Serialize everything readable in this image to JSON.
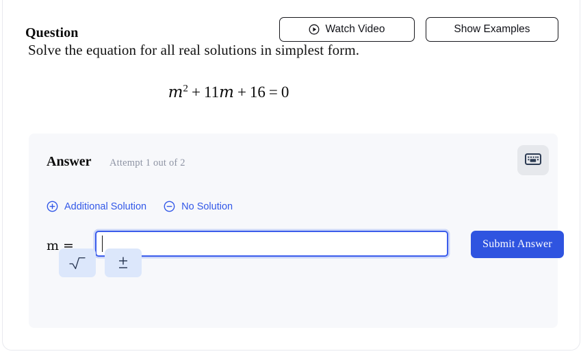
{
  "header": {
    "title": "Question",
    "watch_video_label": "Watch Video",
    "watch_video_icon": "play-circle-icon",
    "show_examples_label": "Show Examples"
  },
  "question": {
    "prompt": "Solve the equation for all real solutions in simplest form.",
    "equation": {
      "variable": "m",
      "exponent": "2",
      "op1": "+",
      "linear_coefficient": "11",
      "linear_variable": "m",
      "op2": "+",
      "constant": "16",
      "equals": "=",
      "right_side": "0",
      "plain": "m^2 + 11m + 16 = 0"
    }
  },
  "answer_panel": {
    "heading": "Answer",
    "attempt_status": "Attempt 1 out of 2",
    "keyboard_button_icon": "keyboard-icon",
    "options": [
      {
        "label": "Additional Solution",
        "icon": "plus-circle-icon"
      },
      {
        "label": "No Solution",
        "icon": "minus-circle-icon"
      }
    ],
    "input": {
      "variable_label": "m =",
      "value": "",
      "placeholder": "",
      "focused": true
    },
    "submit_label": "Submit Answer",
    "math_keys": [
      {
        "label": "√",
        "icon": "square-root-icon",
        "name": "square-root"
      },
      {
        "label": "±",
        "icon": "plus-minus-icon",
        "name": "plus-minus"
      }
    ]
  },
  "colors": {
    "accent_blue": "#2f54e0",
    "link_blue": "#3258e8",
    "math_key_bg": "#dce7fb",
    "panel_bg": "#f7f8fb",
    "keyboard_btn_bg": "#e6e8ec",
    "muted_text": "#8d93a3"
  }
}
